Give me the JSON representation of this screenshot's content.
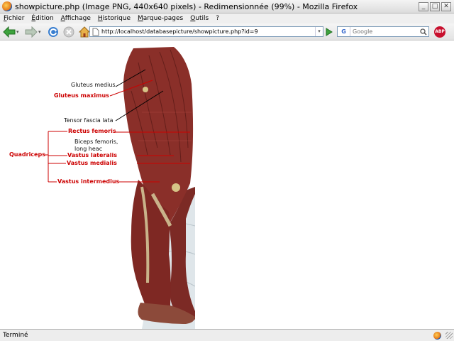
{
  "window": {
    "title": "showpicture.php (Image PNG, 440x640 pixels) - Redimensionnée (99%) - Mozilla Firefox",
    "minimize_glyph": "_",
    "maximize_glyph": "□",
    "close_glyph": "✕"
  },
  "menu": {
    "items": [
      "Fichier",
      "Édition",
      "Affichage",
      "Historique",
      "Marque-pages",
      "Outils",
      "?"
    ]
  },
  "toolbar": {
    "url": "http://localhost/databasepicture/showpicture.php?id=9",
    "search_placeholder": "Google",
    "search_engine": "G",
    "adblock_label": "ABP"
  },
  "anatomy_labels": {
    "gluteus_medius": "Gluteus medius",
    "gluteus_maximus": "Gluteus maximus",
    "tensor_fascia_lata": "Tensor fascia lata",
    "rectus_femoris": "Rectus femoris",
    "biceps_femoris_line1": "Biceps femoris,",
    "biceps_femoris_line2": "long heac",
    "vastus_lateralis": "Vastus lateralis",
    "vastus_medialis": "Vastus medialis",
    "vastus_intermedius": "Vastus intermedius",
    "quadriceps": "Quadriceps"
  },
  "status": {
    "text": "Terminé"
  },
  "colors": {
    "label_red": "#cc0000",
    "muscle": "#8a2a24",
    "url_border": "#7f9db9"
  },
  "icons": {
    "back": "back-arrow-icon",
    "forward": "forward-arrow-icon",
    "reload": "reload-icon",
    "stop": "stop-icon",
    "home": "home-icon"
  }
}
